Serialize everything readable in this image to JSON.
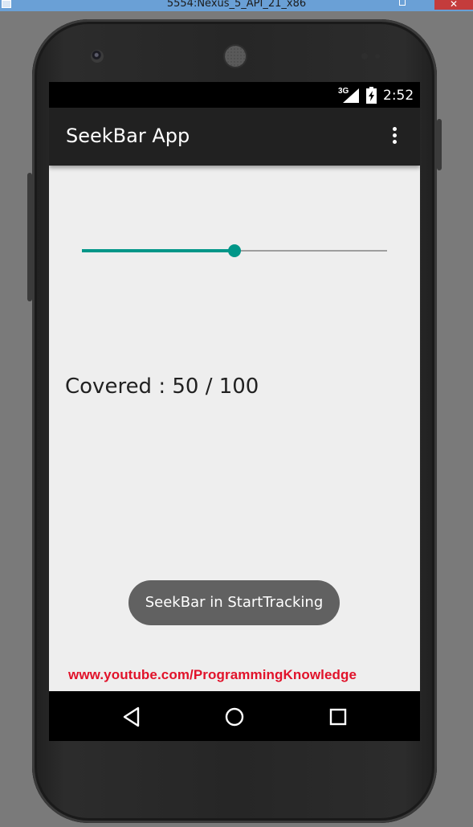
{
  "window": {
    "title": "5554:Nexus_5_API_21_x86",
    "close_glyph": "✕"
  },
  "status_bar": {
    "network": "3G",
    "time": "2:52",
    "icons": [
      "signal-icon",
      "battery-charging-icon"
    ]
  },
  "app_bar": {
    "title": "SeekBar App",
    "menu_icon": "overflow-menu-icon"
  },
  "seekbar": {
    "progress": 50,
    "max": 100,
    "accent_color": "#009688",
    "track_color": "#9e9e9e"
  },
  "content": {
    "covered_label": "Covered : 50 / 100"
  },
  "toast": {
    "message": "SeekBar in StartTracking"
  },
  "watermark": {
    "text": "www.youtube.com/ProgrammingKnowledge",
    "color": "#e1122a"
  },
  "nav_bar": {
    "icons": [
      "back-icon",
      "home-icon",
      "recents-icon"
    ]
  }
}
